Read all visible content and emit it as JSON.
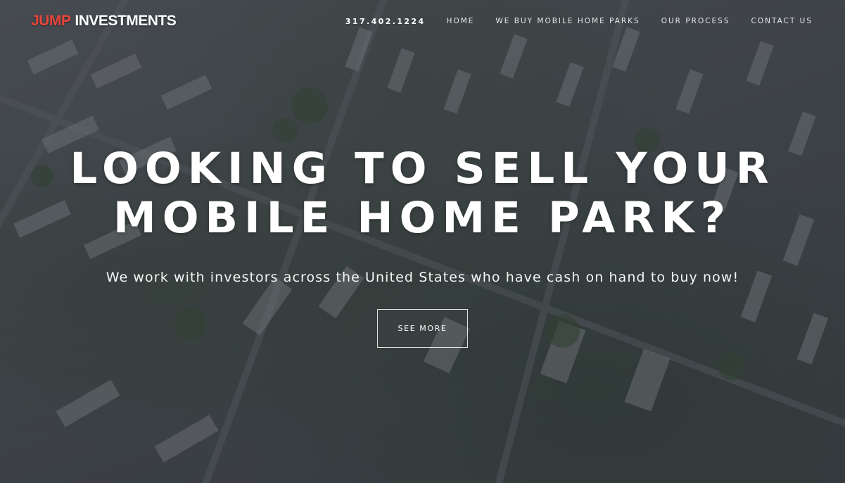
{
  "brand": {
    "logo_word1": "JUMP",
    "logo_word2": "INVESTMENTS",
    "accent_color": "#e8453c"
  },
  "nav": {
    "phone": "317.402.1224",
    "items": [
      {
        "label": "HOME"
      },
      {
        "label": "WE BUY MOBILE HOME PARKS"
      },
      {
        "label": "OUR PROCESS"
      },
      {
        "label": "CONTACT US"
      }
    ]
  },
  "hero": {
    "headline_line1": "LOOKING TO SELL YOUR",
    "headline_line2": "MOBILE HOME PARK?",
    "subheadline": "We work with investors across the United States who have cash on hand to buy now!",
    "cta_label": "SEE MORE",
    "background": "aerial view of a mobile home park"
  }
}
